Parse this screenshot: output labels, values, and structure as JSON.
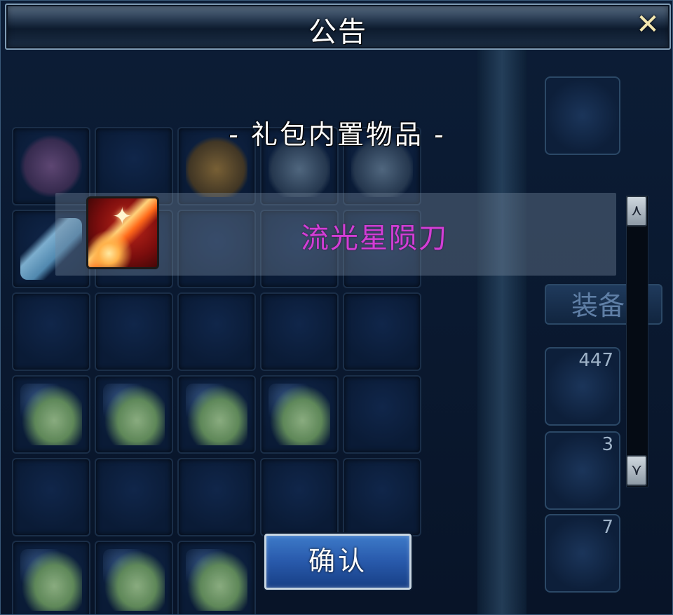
{
  "dialog": {
    "title": "公告",
    "close_glyph": "✕",
    "heading": "- 礼包内置物品 -",
    "item": {
      "name": "流光星陨刀",
      "name_color": "#d23ed6",
      "icon": "sword-icon"
    },
    "confirm_label": "确认"
  },
  "background": {
    "equip_tab_label": "装备",
    "counts": [
      "447",
      "3",
      "7"
    ]
  }
}
